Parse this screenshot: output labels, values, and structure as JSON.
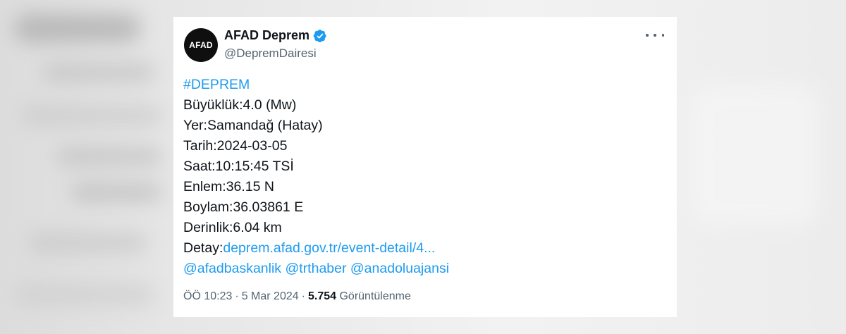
{
  "tweet": {
    "avatar_text": "AFAD",
    "display_name": "AFAD Deprem",
    "handle": "@DepremDairesi",
    "hashtag": "#DEPREM",
    "lines": [
      "Büyüklük:4.0 (Mw)",
      "Yer:Samandağ (Hatay)",
      "Tarih:2024-03-05",
      "Saat:10:15:45 TSİ",
      "Enlem:36.15 N",
      "Boylam:36.03861 E",
      "Derinlik:6.04 km"
    ],
    "detail_label": "Detay:",
    "detail_link": "deprem.afad.gov.tr/event-detail/4...",
    "mentions": [
      "@afadbaskanlik",
      "@trthaber",
      "@anadoluajansi"
    ],
    "time": "ÖÖ 10:23",
    "date": "5 Mar 2024",
    "separator": "·",
    "views_count": "5.754",
    "views_label": "Görüntülenme"
  },
  "colors": {
    "link": "#1d9bf0",
    "verified": "#1d9bf0",
    "text": "#0f1419",
    "muted": "#536471"
  },
  "icons": {
    "verified": "verified-badge-icon",
    "more": "more-horizontal-icon"
  }
}
